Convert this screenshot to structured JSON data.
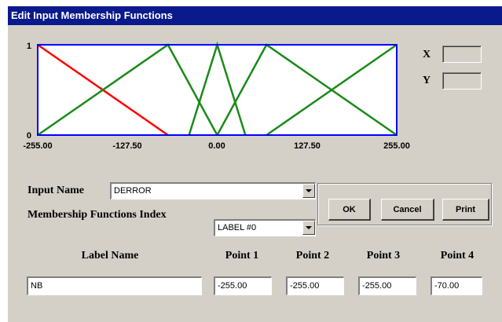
{
  "window": {
    "title": "Edit Input Membership Functions"
  },
  "plot": {
    "y_ticks": [
      "1",
      "0"
    ],
    "x_ticks": [
      "-255.00",
      "-127.50",
      "0.00",
      "127.50",
      "255.00"
    ],
    "x_range": [
      -255,
      255
    ],
    "y_range": [
      0,
      1
    ],
    "colors": {
      "selected": "#ff0000",
      "other": "#1a8a1a",
      "frame": "#0000ff"
    },
    "functions": [
      {
        "points": [
          [
            -255,
            1
          ],
          [
            -70,
            0
          ]
        ],
        "color": "#ff0000"
      },
      {
        "points": [
          [
            -255,
            0
          ],
          [
            -70,
            1
          ],
          [
            0,
            0
          ]
        ],
        "color": "#1a8a1a"
      },
      {
        "points": [
          [
            -40,
            0
          ],
          [
            0,
            1
          ],
          [
            40,
            0
          ]
        ],
        "color": "#1a8a1a"
      },
      {
        "points": [
          [
            0,
            0
          ],
          [
            70,
            1
          ],
          [
            255,
            0
          ]
        ],
        "color": "#1a8a1a"
      },
      {
        "points": [
          [
            70,
            0
          ],
          [
            255,
            1
          ]
        ],
        "color": "#1a8a1a"
      }
    ]
  },
  "coords": {
    "x_label": "X",
    "y_label": "Y",
    "x_value": "",
    "y_value": ""
  },
  "input_name": {
    "label": "Input Name",
    "value": "DERROR"
  },
  "mf_index": {
    "label": "Membership Functions Index",
    "value": "LABEL #0"
  },
  "buttons": {
    "ok": "OK",
    "cancel": "Cancel",
    "print": "Print"
  },
  "table": {
    "headers": [
      "Label Name",
      "Point 1",
      "Point 2",
      "Point 3",
      "Point 4"
    ],
    "row": {
      "label_name": "NB",
      "points": [
        "-255.00",
        "-255.00",
        "-255.00",
        "-70.00"
      ]
    }
  }
}
